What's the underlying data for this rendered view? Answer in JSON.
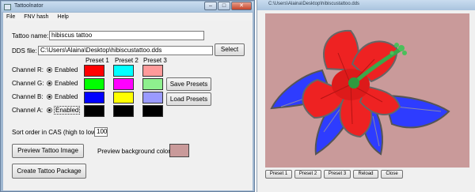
{
  "left_window": {
    "title": "Tattoolnator",
    "menu": [
      "File",
      "FNV hash",
      "Help"
    ],
    "min_glyph": "–",
    "max_glyph": "□",
    "close_glyph": "✕"
  },
  "form": {
    "tattoo_name_label": "Tattoo name:",
    "tattoo_name_value": "hibiscus tattoo",
    "dds_label": "DDS file:",
    "dds_value": "C:\\Users\\Alaina\\Desktop\\hibiscustattoo.dds",
    "select_button": "Select",
    "preset_headers": [
      "Preset 1",
      "Preset 2",
      "Preset 3"
    ],
    "channels": [
      {
        "label": "Channel R:",
        "enabled": "Enabled",
        "colors": [
          "#ff0000",
          "#00ffff",
          "#ff9a9a"
        ]
      },
      {
        "label": "Channel G:",
        "enabled": "Enabled",
        "colors": [
          "#00ff00",
          "#ff00ff",
          "#8ef08e"
        ]
      },
      {
        "label": "Channel B:",
        "enabled": "Enabled",
        "colors": [
          "#0000ff",
          "#ffff00",
          "#9a9aff"
        ]
      },
      {
        "label": "Channel A:",
        "enabled": "Enabled",
        "colors": [
          "#000000",
          "#000000",
          "#000000"
        ]
      }
    ],
    "save_presets": "Save Presets",
    "load_presets": "Load Presets",
    "sort_label": "Sort order in CAS (high to low):",
    "sort_value": "100",
    "preview_button": "Preview Tattoo Image",
    "preview_bg_label": "Preview background color:",
    "preview_bg_color": "#c99a9a",
    "create_button": "Create Tattoo Package"
  },
  "right_window": {
    "title": "C:\\Users\\Alaina\\Desktop\\hibiscustattoo.dds",
    "buttons": [
      "Preset 1",
      "Preset 2",
      "Preset 3",
      "Reload",
      "Close"
    ]
  }
}
